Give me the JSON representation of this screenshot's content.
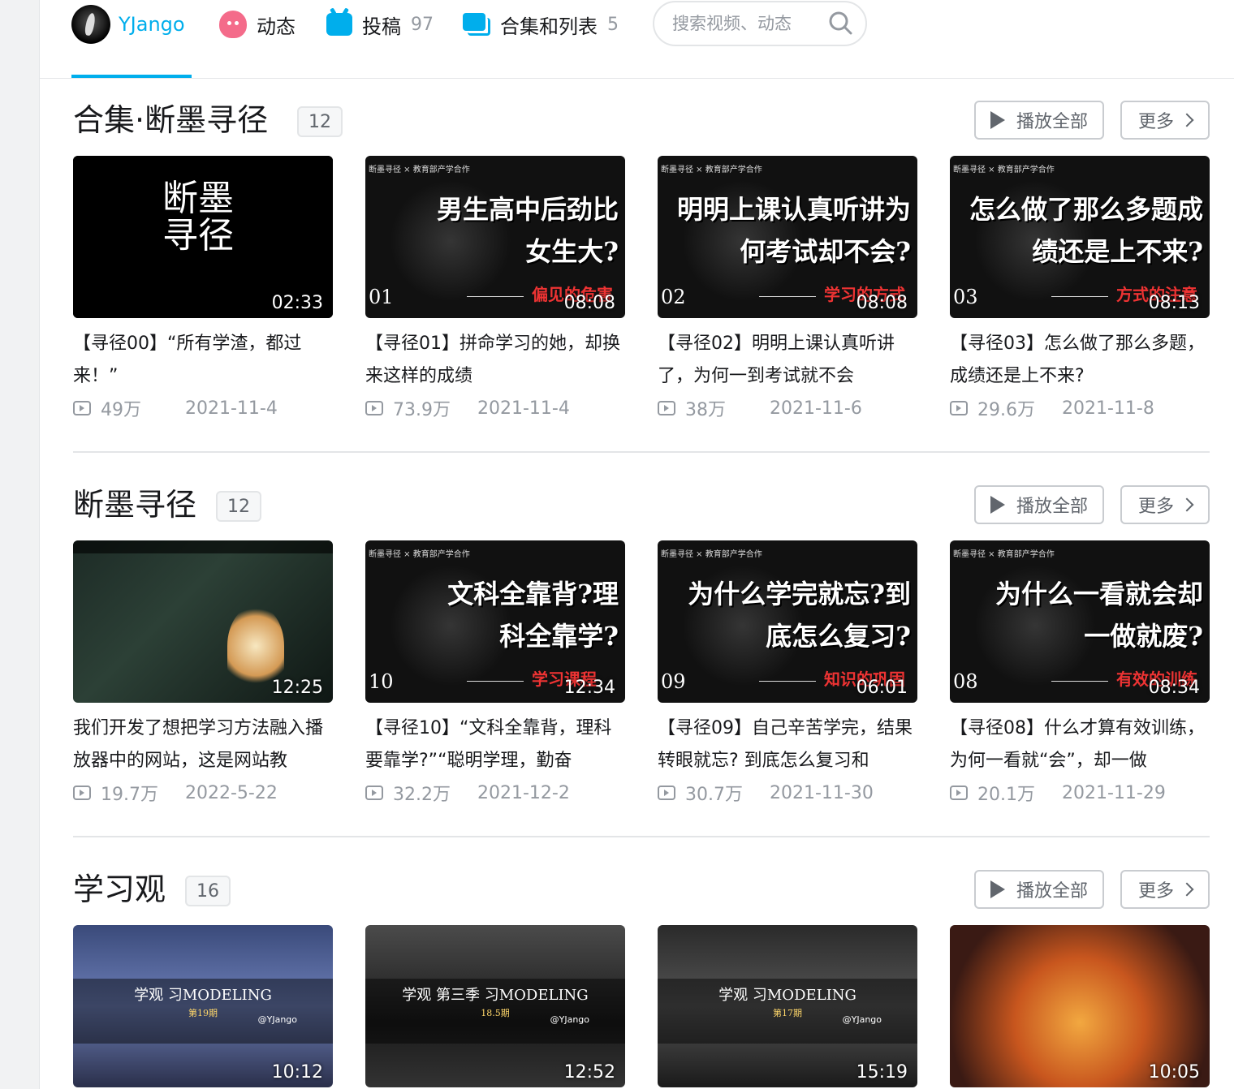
{
  "nav": {
    "username": "YJango",
    "dynamic_label": "动态",
    "upload_label": "投稿",
    "upload_count": "97",
    "collections_label": "合集和列表",
    "collections_count": "5",
    "search_placeholder": "搜索视频、动态"
  },
  "actions": {
    "play_all": "播放全部",
    "more": "更多"
  },
  "sections": [
    {
      "title": "合集·断墨寻径",
      "count": "12",
      "videos": [
        {
          "cover_type": "series-logo",
          "cover_calligraphy": "断墨寻径",
          "duration": "02:33",
          "title": "【寻径00】“所有学渣，都过来！”",
          "views": "49万",
          "date": "2021-11-4"
        },
        {
          "cover_header": "断墨寻径 × 教育部产学合作",
          "cover_text": "男生高中后劲比女生大?",
          "cover_num": "01",
          "cover_red": "偏见的危害",
          "duration": "08:08",
          "title": "【寻径01】拼命学习的她，却换来这样的成绩",
          "views": "73.9万",
          "date": "2021-11-4"
        },
        {
          "cover_header": "断墨寻径 × 教育部产学合作",
          "cover_text": "明明上课认真听讲为何考试却不会?",
          "cover_num": "02",
          "cover_red": "学习的方式",
          "duration": "08:08",
          "title": "【寻径02】明明上课认真听讲了，为何一到考试就不会",
          "views": "38万",
          "date": "2021-11-6"
        },
        {
          "cover_header": "断墨寻径 × 教育部产学合作",
          "cover_text": "怎么做了那么多题成绩还是上不来?",
          "cover_num": "03",
          "cover_red": "方式的注意",
          "duration": "08:13",
          "title": "【寻径03】怎么做了那么多题，成绩还是上不来?",
          "views": "29.6万",
          "date": "2021-11-8"
        }
      ]
    },
    {
      "title": "断墨寻径",
      "count": "12",
      "videos": [
        {
          "cover_type": "website",
          "duration": "12:25",
          "title": "我们开发了想把学习方法融入播放器中的网站，这是网站教",
          "views": "19.7万",
          "date": "2022-5-22"
        },
        {
          "cover_header": "断墨寻径 × 教育部产学合作",
          "cover_text": "文科全靠背?理科全靠学?",
          "cover_num": "10",
          "cover_red": "学习课程",
          "duration": "12:34",
          "title": "【寻径10】“文科全靠背，理科要靠学?”“聪明学理，勤奋",
          "views": "32.2万",
          "date": "2021-12-2"
        },
        {
          "cover_header": "断墨寻径 × 教育部产学合作",
          "cover_text": "为什么学完就忘?到底怎么复习?",
          "cover_num": "09",
          "cover_red": "知识的巩固",
          "duration": "06:01",
          "title": "【寻径09】自己辛苦学完，结果转眼就忘? 到底怎么复习和",
          "views": "30.7万",
          "date": "2021-11-30"
        },
        {
          "cover_header": "断墨寻径 × 教育部产学合作",
          "cover_text": "为什么一看就会却一做就废?",
          "cover_num": "08",
          "cover_red": "有效的训练",
          "duration": "08:34",
          "title": "【寻径08】什么才算有效训练，为何一看就“会”，却一做",
          "views": "20.1万",
          "date": "2021-11-29"
        }
      ]
    },
    {
      "title": "学习观",
      "count": "16",
      "videos": [
        {
          "cover_type": "art",
          "art_title": "学观 习MODELING",
          "art_sub": "第19期",
          "art_handle": "@YJango",
          "duration": "10:12"
        },
        {
          "cover_type": "art",
          "art_title": "学观 第三季 习MODELING",
          "art_sub": "18.5期",
          "art_handle": "@YJango",
          "duration": "12:52"
        },
        {
          "cover_type": "art",
          "art_title": "学观 习MODELING",
          "art_sub": "第17期",
          "art_handle": "@YJango",
          "duration": "15:19"
        },
        {
          "cover_type": "art",
          "duration": "10:05"
        }
      ]
    }
  ],
  "colors": {
    "accent": "#00aeec",
    "text_secondary": "#9499a0",
    "cover_red": "#e33333"
  },
  "icons": [
    "avatar",
    "dynamic-icon",
    "upload-icon",
    "collection-icon",
    "search-icon",
    "play-icon",
    "chevron-right-icon",
    "view-count-icon"
  ]
}
